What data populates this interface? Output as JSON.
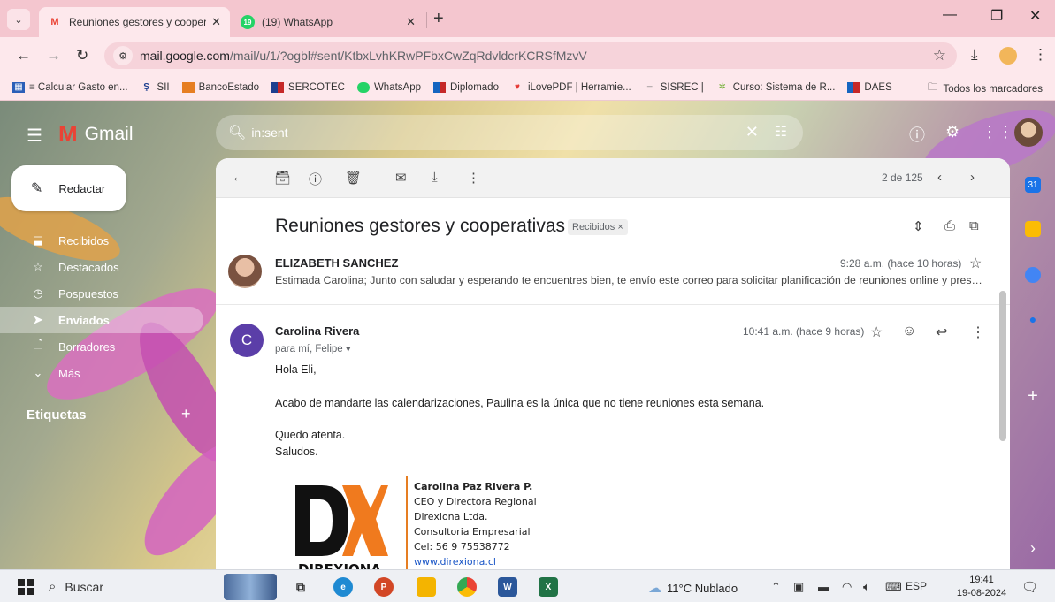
{
  "browser": {
    "tabs": [
      {
        "title": "Reuniones gestores y cooperati",
        "favicon": "gmail-icon",
        "active": true
      },
      {
        "title": "(19) WhatsApp",
        "favicon": "whatsapp-icon",
        "active": false
      }
    ],
    "url_host": "mail.google.com",
    "url_path": "/mail/u/1/?ogbl#sent/KtbxLvhKRwPFbxCwZqRdvldcrKCRSfMzvV",
    "bookmarks": [
      {
        "label": "≡ Calcular Gasto en...",
        "icon": "calculator-icon",
        "color": "#2b5fb8"
      },
      {
        "label": "SII",
        "icon": "sii-icon",
        "color": "#1d3f8f"
      },
      {
        "label": "BancoEstado",
        "icon": "bank-icon",
        "color": "#e67e22"
      },
      {
        "label": "SERCOTEC",
        "icon": "sercotec-icon",
        "color": "#c62828"
      },
      {
        "label": "WhatsApp",
        "icon": "whatsapp-icon",
        "color": "#25d366"
      },
      {
        "label": "Diplomado",
        "icon": "flag-icon",
        "color": "#1565c0"
      },
      {
        "label": "iLovePDF | Herramie...",
        "icon": "heart-icon",
        "color": "#e53935"
      },
      {
        "label": "SISREC |",
        "icon": "sisrec-icon",
        "color": "#777777"
      },
      {
        "label": "Curso: Sistema de R...",
        "icon": "course-icon",
        "color": "#9ccc65"
      },
      {
        "label": "DAES",
        "icon": "flag-icon",
        "color": "#1565c0"
      }
    ],
    "all_bookmarks": "Todos los marcadores"
  },
  "gmail": {
    "logo_text": "Gmail",
    "search_value": "in:sent",
    "compose_label": "Redactar",
    "nav": [
      {
        "label": "Recibidos",
        "icon": "inbox-icon",
        "active": false
      },
      {
        "label": "Destacados",
        "icon": "star-icon",
        "active": false
      },
      {
        "label": "Pospuestos",
        "icon": "clock-icon",
        "active": false
      },
      {
        "label": "Enviados",
        "icon": "send-icon",
        "active": true
      },
      {
        "label": "Borradores",
        "icon": "draft-icon",
        "active": false
      },
      {
        "label": "Más",
        "icon": "chevron-down-icon",
        "active": false
      }
    ],
    "labels_title": "Etiquetas",
    "pager": "2 de 125"
  },
  "thread": {
    "subject": "Reuniones gestores y cooperativas",
    "label_badge": "Recibidos ×",
    "messages": [
      {
        "sender": "ELIZABETH SANCHEZ",
        "time": "9:28 a.m. (hace 10 horas)",
        "snippet": "Estimada Carolina; Junto con saludar y esperando te encuentres bien, te envío este correo para solicitar planificación de reuniones online y presenciales"
      },
      {
        "sender": "Carolina Rivera",
        "avatar_letter": "C",
        "to": "para mí, Felipe",
        "time": "10:41 a.m. (hace 9 horas)",
        "body": [
          "Hola Eli,",
          "Acabo de mandarte las calendarizaciones, Paulina es la única que no tiene reuniones esta semana.",
          "Quedo atenta.",
          "Saludos."
        ]
      }
    ],
    "signature": {
      "logo_letters": "DX",
      "logo_word": "DIREXIONA",
      "name": "Carolina Paz Rivera P.",
      "title": "CEO y Directora Regional",
      "company": "Direxiona Ltda.",
      "type": "Consultoria Empresarial",
      "phone": "Cel: 56 9 75538772",
      "website": "www.direxiona.cl"
    }
  },
  "taskbar": {
    "search_label": "Buscar",
    "weather": "11°C Nublado",
    "lang": "ESP",
    "time": "19:41",
    "date": "19-08-2024"
  },
  "colors": {
    "tab_bar": "#f4c6cf",
    "accent_purple": "#5b3ea8",
    "gmail_red": "#ea4335"
  }
}
